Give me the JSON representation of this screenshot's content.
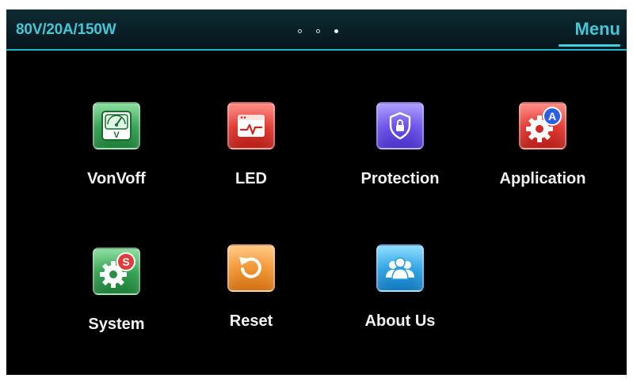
{
  "header": {
    "model": "80V/20A/150W",
    "menu_label": "Menu",
    "page_indicator": {
      "total": 3,
      "active_index": 2
    }
  },
  "apps": [
    {
      "label": "VonVoff",
      "icon": "voltmeter-icon",
      "color": "#2e9e4c"
    },
    {
      "label": "LED",
      "icon": "waveform-window-icon",
      "color": "#e0342c"
    },
    {
      "label": "Protection",
      "icon": "shield-lock-icon",
      "color": "#6a4fe6"
    },
    {
      "label": "Application",
      "icon": "gear-a-badge-icon",
      "color": "#e0342c"
    },
    {
      "label": "System",
      "icon": "gear-s-badge-icon",
      "color": "#2e9e4c"
    },
    {
      "label": "Reset",
      "icon": "reset-arrow-icon",
      "color": "#f0932f"
    },
    {
      "label": "About Us",
      "icon": "users-icon",
      "color": "#2a9fdf"
    }
  ],
  "badges": {
    "application": "A",
    "system": "S",
    "voltmeter": "V"
  }
}
